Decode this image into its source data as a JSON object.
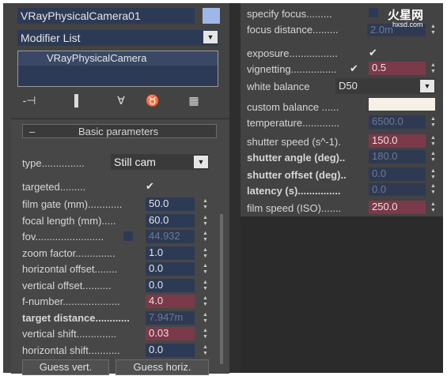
{
  "top": {
    "object_name": "VRayPhysicalCamera01",
    "color_swatch": "#9fb7e6",
    "modifier_list": "Modifier List",
    "stack_item": "VRayPhysicalCamera"
  },
  "toolbar": {
    "icons": [
      "pin-stack-icon",
      "show-end-result-icon",
      "make-unique-icon",
      "remove-modifier-icon",
      "configure-modifier-sets-icon"
    ],
    "glyphs": [
      "-⊣",
      "▌",
      "∀",
      "♉",
      "▦"
    ]
  },
  "basic": {
    "rollout_sign": "–",
    "rollout_title": "Basic parameters",
    "type_label": "type...............",
    "type_value": "Still cam",
    "targeted_label": "targeted.........",
    "check": "✔",
    "rows": [
      {
        "label": "film gate (mm)............",
        "value": "50.0",
        "style": "normal"
      },
      {
        "label": "focal length (mm).....",
        "value": "60.0",
        "style": "normal"
      },
      {
        "label": "fov........................",
        "value": "44.932",
        "style": "dim"
      },
      {
        "label": "zoom factor..............",
        "value": "1.0",
        "style": "normal"
      },
      {
        "label": "horizontal offset........",
        "value": "0.0",
        "style": "normal"
      },
      {
        "label": "vertical offset..........",
        "value": "0.0",
        "style": "normal"
      },
      {
        "label": "f-number....................",
        "value": "4.0",
        "style": "red"
      },
      {
        "label": "target distance............",
        "value": "7.947m",
        "style": "dim"
      },
      {
        "label": "vertical shift..............",
        "value": "0.03",
        "style": "red"
      },
      {
        "label": "horizontal shift...........",
        "value": "0.0",
        "style": "normal"
      }
    ],
    "guess_vert": "Guess vert.",
    "guess_horiz": "Guess horiz."
  },
  "right": {
    "specify_focus_label": "specify focus.........",
    "focus_distance_label": "focus distance.........",
    "focus_distance_value": "2.0m",
    "exposure_label": "exposure.................",
    "vignetting_label": "vignetting................",
    "vignetting_value": "0.5",
    "white_balance_label": "white balance",
    "white_balance_value": "D50",
    "custom_balance_label": "custom balance ......",
    "custom_balance_color": "#f6f0e6",
    "temperature_label": "temperature.............",
    "temperature_value": "6500.0",
    "shutter_speed_label": "shutter speed (s^-1).",
    "shutter_speed_value": "150.0",
    "shutter_angle_label": "shutter angle (deg)..",
    "shutter_angle_value": "180.0",
    "shutter_offset_label": "shutter offset (deg)..",
    "shutter_offset_value": "0.0",
    "latency_label": "latency (s)...............",
    "latency_value": "0.0",
    "film_speed_label": "film speed (ISO).......",
    "film_speed_value": "250.0"
  },
  "watermark": {
    "logo": "火星网",
    "url": "hxsd.com"
  }
}
